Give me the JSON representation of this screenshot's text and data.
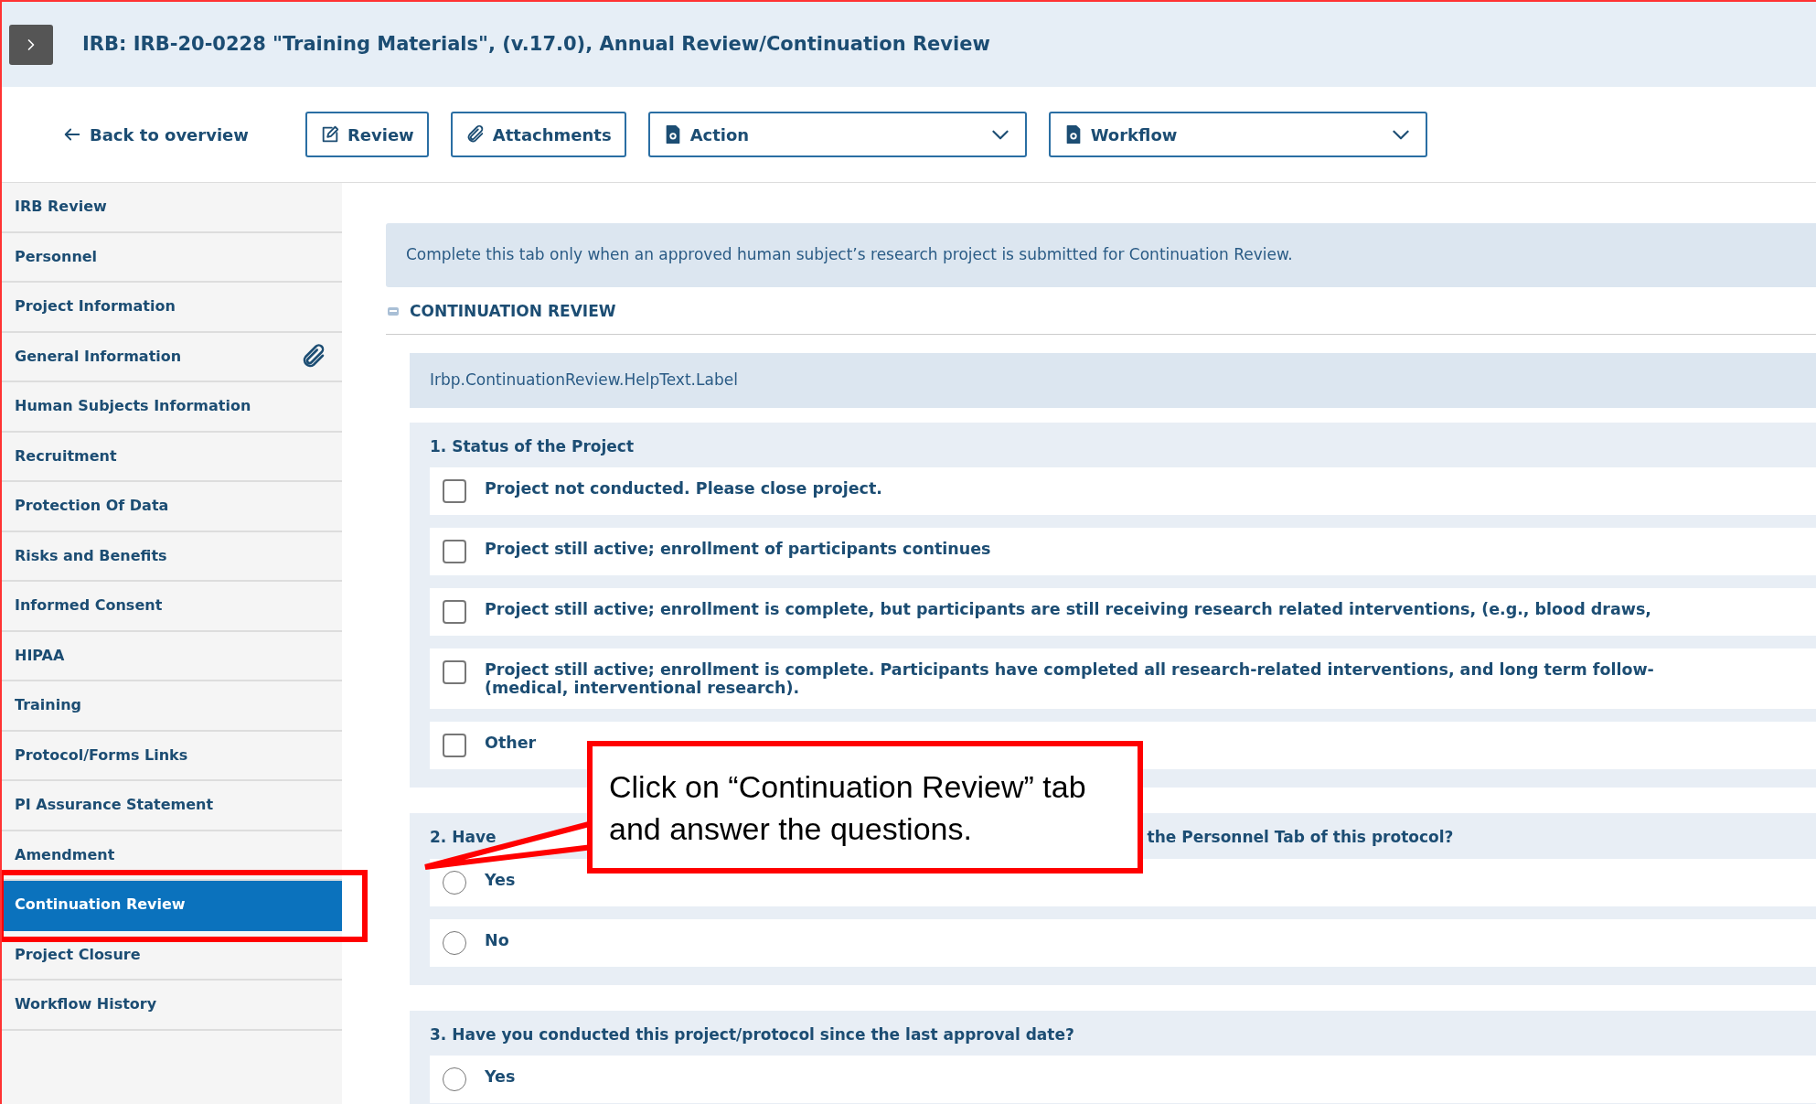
{
  "header": {
    "title": "IRB: IRB-20-0228 \"Training Materials\", (v.17.0), Annual Review/Continuation Review"
  },
  "toolbar": {
    "back_link": "Back to overview",
    "buttons": [
      {
        "label": "Review",
        "kind": "button"
      },
      {
        "label": "Attachments",
        "kind": "button"
      },
      {
        "label": "Action",
        "kind": "dropdown"
      },
      {
        "label": "Workflow",
        "kind": "dropdown"
      }
    ]
  },
  "sidebar": {
    "items": [
      {
        "label": "IRB Review",
        "selected": false,
        "attachment": false
      },
      {
        "label": "Personnel",
        "selected": false,
        "attachment": false
      },
      {
        "label": "Project Information",
        "selected": false,
        "attachment": false
      },
      {
        "label": "General Information",
        "selected": false,
        "attachment": true
      },
      {
        "label": "Human Subjects Information",
        "selected": false,
        "attachment": false
      },
      {
        "label": "Recruitment",
        "selected": false,
        "attachment": false
      },
      {
        "label": "Protection Of Data",
        "selected": false,
        "attachment": false
      },
      {
        "label": "Risks and Benefits",
        "selected": false,
        "attachment": false
      },
      {
        "label": "Informed Consent",
        "selected": false,
        "attachment": false
      },
      {
        "label": "HIPAA",
        "selected": false,
        "attachment": false
      },
      {
        "label": "Training",
        "selected": false,
        "attachment": false
      },
      {
        "label": "Protocol/Forms Links",
        "selected": false,
        "attachment": false
      },
      {
        "label": "PI Assurance Statement",
        "selected": false,
        "attachment": false
      },
      {
        "label": "Amendment",
        "selected": false,
        "attachment": false
      },
      {
        "label": "Continuation Review",
        "selected": true,
        "attachment": false
      },
      {
        "label": "Project Closure",
        "selected": false,
        "attachment": false
      },
      {
        "label": "Workflow History",
        "selected": false,
        "attachment": false
      }
    ]
  },
  "info_text": "Complete this tab only when an approved human subject’s research project is submitted for Continuation Review.",
  "section": {
    "title": "CONTINUATION REVIEW",
    "expanded": true,
    "help_text": "Irbp.ContinuationReview.HelpText.Label",
    "questions": [
      {
        "title": [
          "1. Status of the Project"
        ],
        "kind": "checkbox",
        "options": [
          {
            "lines": [
              "Project not conducted. Please close project."
            ],
            "checked": false
          },
          {
            "lines": [
              "Project still active; enrollment of participants continues"
            ],
            "checked": false
          },
          {
            "lines": [
              "Project still active; enrollment is complete, but participants are still receiving research related interventions, (e.g., blood draws,"
            ],
            "checked": false
          },
          {
            "lines": [
              "Project still active; enrollment is complete. Participants have completed all research-related interventions, and long term follow-",
              "(medical, interventional research)."
            ],
            "checked": false
          },
          {
            "lines": [
              "Other"
            ],
            "checked": false
          }
        ]
      },
      {
        "title": [
          "2. Have",
          "the Personnel Tab of this protocol?"
        ],
        "kind": "radio",
        "options": [
          {
            "lines": [
              "Yes"
            ],
            "checked": false
          },
          {
            "lines": [
              "No"
            ],
            "checked": false
          }
        ]
      },
      {
        "title": [
          "3. Have you conducted this project/protocol since the last approval date?"
        ],
        "kind": "radio",
        "options": [
          {
            "lines": [
              "Yes"
            ],
            "checked": false
          }
        ]
      }
    ]
  },
  "callout": {
    "text": "Click on “Continuation Review” tab and answer the questions."
  }
}
